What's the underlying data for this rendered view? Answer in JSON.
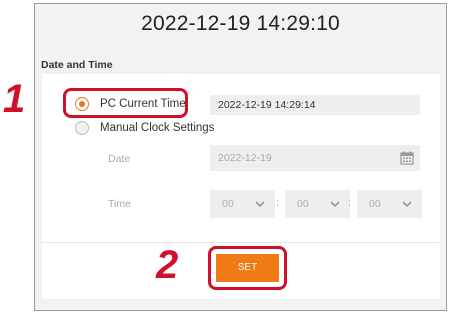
{
  "header": {
    "clock": "2022-12-19 14:29:10"
  },
  "section": {
    "title": "Date and Time"
  },
  "options": {
    "pc_current_time": {
      "label": "PC Current Time",
      "value": "2022-12-19 14:29:14",
      "selected": true
    },
    "manual_clock": {
      "label": "Manual Clock Settings",
      "selected": false
    }
  },
  "manual": {
    "date_label": "Date",
    "date_value": "2022-12-19",
    "time_label": "Time",
    "hour": "00",
    "minute": "00",
    "second": "00",
    "separator": ":"
  },
  "actions": {
    "set_label": "SET"
  },
  "annotations": {
    "step1": "1",
    "step2": "2"
  },
  "colors": {
    "accent": "#f07b15",
    "callout": "#d0102a"
  },
  "icons": {
    "calendar": "calendar-icon",
    "chevron": "chevron-down-icon"
  }
}
